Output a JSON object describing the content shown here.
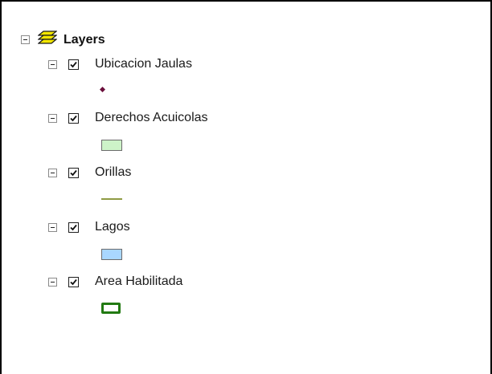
{
  "toc": {
    "root": {
      "label": "Layers",
      "icon": "layers-stack-icon"
    },
    "layers": [
      {
        "label": "Ubicacion Jaulas",
        "checked": true,
        "symbol": "point",
        "color": "#6b0f3c"
      },
      {
        "label": "Derechos Acuicolas",
        "checked": true,
        "symbol": "fill",
        "color": "#cdf3c8"
      },
      {
        "label": "Orillas",
        "checked": true,
        "symbol": "line",
        "color": "#8f9b44"
      },
      {
        "label": "Lagos",
        "checked": true,
        "symbol": "fill",
        "color": "#a9d7ff"
      },
      {
        "label": "Area Habilitada",
        "checked": true,
        "symbol": "outline",
        "color": "#227a12"
      }
    ]
  }
}
